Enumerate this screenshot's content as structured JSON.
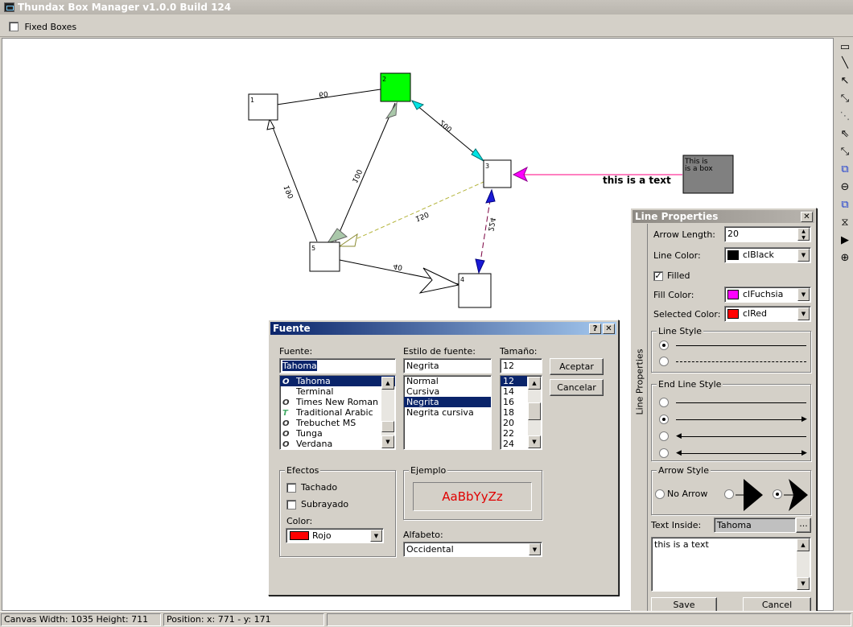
{
  "window": {
    "title": "Thundax Box Manager v1.0.0 Build 124"
  },
  "toolbar": {
    "fixed_boxes_label": "Fixed Boxes"
  },
  "canvas": {
    "boxes": [
      {
        "id": "1",
        "label": "1"
      },
      {
        "id": "2",
        "label": "2"
      },
      {
        "id": "3",
        "label": "3"
      },
      {
        "id": "4",
        "label": "4"
      },
      {
        "id": "5",
        "label": "5"
      }
    ],
    "text_box_lines": [
      "This is",
      "is a box"
    ],
    "edge_labels": [
      "60",
      "200",
      "100",
      "190",
      "150",
      "224",
      "40"
    ],
    "floating_text": "this is a text",
    "colors": {
      "box2": "#00ff00",
      "text_box": "#808080",
      "line_pink": "#ff0080",
      "arrow_fuchsia": "#ff00ff",
      "arrow_cyan": "#00e5e5",
      "arrow_blue": "#1a1ad6",
      "arrow_green": "#aac8aa"
    }
  },
  "tools": [
    "rectangle-tool-icon",
    "line-tool-icon",
    "arrow-line-icon",
    "double-arrow-line-icon",
    "dashed-line-icon",
    "dashed-arrow-icon",
    "dashed-double-arrow-icon",
    "bring-front-icon",
    "delete-icon",
    "send-back-icon",
    "align-icon",
    "play-icon",
    "add-icon"
  ],
  "font_dialog": {
    "title": "Fuente",
    "font_label": "Fuente:",
    "font_value": "Tahoma",
    "fonts": [
      "Tahoma",
      "Terminal",
      "Times New Roman",
      "Traditional Arabic",
      "Trebuchet MS",
      "Tunga",
      "Verdana"
    ],
    "style_label": "Estilo de fuente:",
    "style_value": "Negrita",
    "styles": [
      "Normal",
      "Cursiva",
      "Negrita",
      "Negrita cursiva"
    ],
    "size_label": "Tamaño:",
    "size_value": "12",
    "sizes": [
      "12",
      "14",
      "16",
      "18",
      "20",
      "22",
      "24"
    ],
    "accept": "Aceptar",
    "cancel": "Cancelar",
    "effects_title": "Efectos",
    "strike": "Tachado",
    "underline": "Subrayado",
    "color_label": "Color:",
    "color_value": "Rojo",
    "sample_title": "Ejemplo",
    "sample_text": "AaBbYyZz",
    "script_label": "Alfabeto:",
    "script_value": "Occidental"
  },
  "line_props": {
    "title": "Line Properties",
    "side_label": "Line Properties",
    "arrow_length_label": "Arrow Length:",
    "arrow_length": "20",
    "line_color_label": "Line Color:",
    "line_color": "clBlack",
    "filled_label": "Filled",
    "fill_color_label": "Fill Color:",
    "fill_color": "clFuchsia",
    "selected_color_label": "Selected Color:",
    "selected_color": "clRed",
    "line_style_title": "Line Style",
    "end_line_style_title": "End Line Style",
    "arrow_style_title": "Arrow Style",
    "no_arrow": "No Arrow",
    "text_inside_label": "Text Inside:",
    "text_inside_font": "Tahoma",
    "ellipsis": "...",
    "text_value": "this is a text",
    "save": "Save",
    "cancel": "Cancel"
  },
  "status": {
    "canvas_size": "Canvas Width: 1035 Height: 711 Pixels",
    "position": "Position: x: 771 - y: 171"
  }
}
